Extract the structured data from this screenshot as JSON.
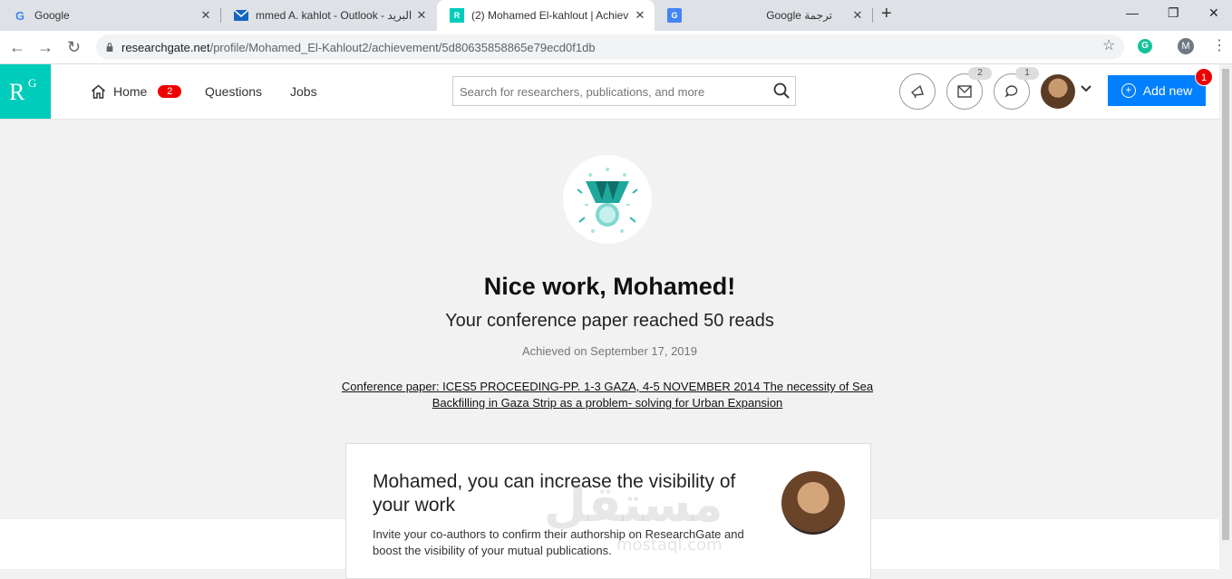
{
  "browser": {
    "tabs": [
      {
        "title": "Google",
        "icon": "google-icon"
      },
      {
        "title": "mmed A. kahlot - Outlook - البريد",
        "icon": "mail-icon"
      },
      {
        "title": "(2) Mohamed El-kahlout | Achiev",
        "icon": "researchgate-icon"
      },
      {
        "title": "Google ترجمة",
        "icon": "translate-icon"
      }
    ],
    "url_host": "researchgate.net",
    "url_path": "/profile/Mohamed_El-Kahlout2/achievement/5d80635858865e79ecd0f1db",
    "profile_initial": "M",
    "extension_letter": "G"
  },
  "header": {
    "logo_r": "R",
    "logo_g": "G",
    "nav": {
      "home": "Home",
      "home_badge": "2",
      "questions": "Questions",
      "jobs": "Jobs"
    },
    "search_placeholder": "Search for researchers, publications, and more",
    "messages_count": "2",
    "notifications_count": "1",
    "add_new": "Add new",
    "add_new_badge": "1",
    "accent": "#00ccbb",
    "button_color": "#0080ff"
  },
  "achievement": {
    "headline": "Nice work, Mohamed!",
    "subheadline": "Your conference paper reached 50 reads",
    "date": "Achieved on September 17, 2019",
    "paper_line1": "Conference paper: ICES5 PROCEEDING-PP. 1-3 GAZA, 4-5 NOVEMBER 2014 The necessity of Sea",
    "paper_line2": "Backfilling in Gaza Strip as a problem- solving for Urban Expansion"
  },
  "card": {
    "title": "Mohamed, you can increase the visibility of your work",
    "text": "Invite your co-authors to confirm their authorship on ResearchGate and boost the visibility of your mutual publications."
  },
  "watermark": {
    "main": "مستقل",
    "sub": "mostaql.com"
  }
}
